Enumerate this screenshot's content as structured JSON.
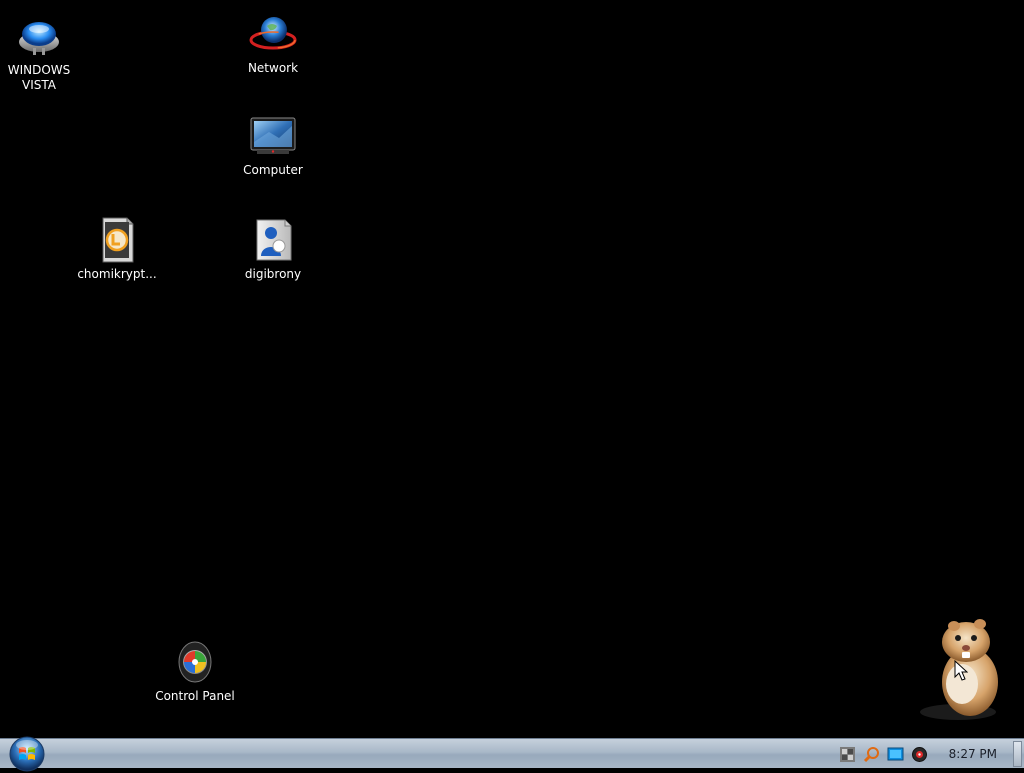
{
  "desktop": {
    "icons": [
      {
        "label": "WINDOWS VISTA",
        "icon": "vista-orb-icon"
      },
      {
        "label": "Network",
        "icon": "network-globe-icon"
      },
      {
        "label": "Computer",
        "icon": "computer-monitor-icon"
      },
      {
        "label": "chomikrypt...",
        "icon": "chomikrypt-lock-icon"
      },
      {
        "label": "digibrony",
        "icon": "digibrony-app-icon"
      },
      {
        "label": "Control Panel",
        "icon": "control-panel-icon"
      }
    ],
    "gadget": {
      "icon": "hamster-icon"
    }
  },
  "taskbar": {
    "start_icon": "start-orb-icon",
    "tray_icons": [
      "network-tray-icon",
      "search-tray-icon",
      "display-tray-icon",
      "media-tray-icon"
    ],
    "clock": "8:27 PM"
  },
  "colors": {
    "desktop_background": "#000000",
    "taskbar": "#a9b8c8",
    "label_text": "#ffffff"
  }
}
